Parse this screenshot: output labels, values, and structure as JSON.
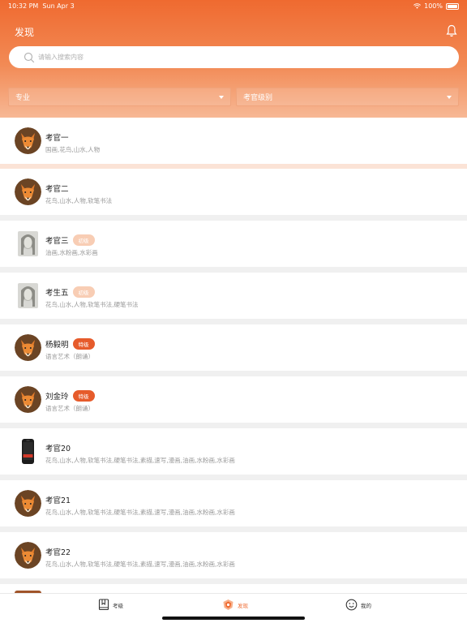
{
  "status_bar": {
    "time": "10:32 PM",
    "date": "Sun Apr 3",
    "battery": "100%"
  },
  "header": {
    "title": "发现",
    "bell_icon": "bell-icon"
  },
  "search": {
    "placeholder": "请输入搜索内容",
    "value": ""
  },
  "filters": {
    "major": "专业",
    "level": "考官级别"
  },
  "examiners": [
    {
      "name": "考官一",
      "badge": "",
      "subjects": "国画,花鸟,山水,人物",
      "avatar": "fox"
    },
    {
      "name": "考官二",
      "badge": "",
      "subjects": "花鸟,山水,人物,软笔书法",
      "avatar": "fox"
    },
    {
      "name": "考官三",
      "badge": "初级",
      "subjects": "油画,水粉画,水彩画",
      "avatar": "portrait"
    },
    {
      "name": "考生五",
      "badge": "初级",
      "subjects": "花鸟,山水,人物,软笔书法,硬笔书法",
      "avatar": "portrait"
    },
    {
      "name": "杨毅明",
      "badge": "特级",
      "subjects": "语言艺术（朗诵）",
      "avatar": "fox"
    },
    {
      "name": "刘金玲",
      "badge": "特级",
      "subjects": "语言艺术（朗诵）",
      "avatar": "fox"
    },
    {
      "name": "考官20",
      "badge": "",
      "subjects": "花鸟,山水,人物,软笔书法,硬笔书法,素描,速写,漫画,油画,水粉画,水彩画",
      "avatar": "phone"
    },
    {
      "name": "考官21",
      "badge": "",
      "subjects": "花鸟,山水,人物,软笔书法,硬笔书法,素描,速写,漫画,油画,水粉画,水彩画",
      "avatar": "fox"
    },
    {
      "name": "考官22",
      "badge": "",
      "subjects": "花鸟,山水,人物,软笔书法,硬笔书法,素描,速写,漫画,油画,水粉画,水彩画",
      "avatar": "fox"
    }
  ],
  "tabbar": {
    "tabs": [
      {
        "label": "考级",
        "icon": "book-icon"
      },
      {
        "label": "发现",
        "icon": "discover-icon"
      },
      {
        "label": "我的",
        "icon": "smiley-icon"
      }
    ],
    "active": "发现"
  },
  "colors": {
    "accent": "#ef6a30",
    "badge_strong": "#e65b2b",
    "badge_light": "#f8cdb4"
  }
}
